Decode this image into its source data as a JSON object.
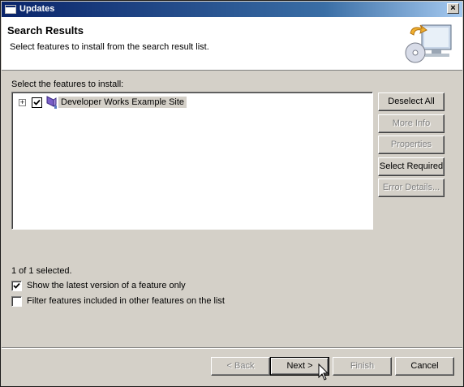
{
  "window": {
    "title": "Updates"
  },
  "header": {
    "title": "Search Results",
    "description": "Select features to install from the search result list."
  },
  "features": {
    "label": "Select the features to install:",
    "items": [
      {
        "label": "Developer Works Example Site",
        "checked": true,
        "expanded": false
      }
    ]
  },
  "side_buttons": {
    "deselect_all": "Deselect All",
    "more_info": "More Info",
    "properties": "Properties",
    "select_required": "Select Required",
    "error_details": "Error Details..."
  },
  "status": "1 of 1 selected.",
  "options": {
    "latest_version": {
      "label": "Show the latest version of a feature only",
      "checked": true
    },
    "filter_included": {
      "label": "Filter features included in other features on the list",
      "checked": false
    }
  },
  "nav": {
    "back": "< Back",
    "next": "Next >",
    "finish": "Finish",
    "cancel": "Cancel"
  },
  "colors": {
    "titlebar": "#0a246a",
    "dialog_bg": "#d4d0c8",
    "disabled_text": "#808080"
  }
}
